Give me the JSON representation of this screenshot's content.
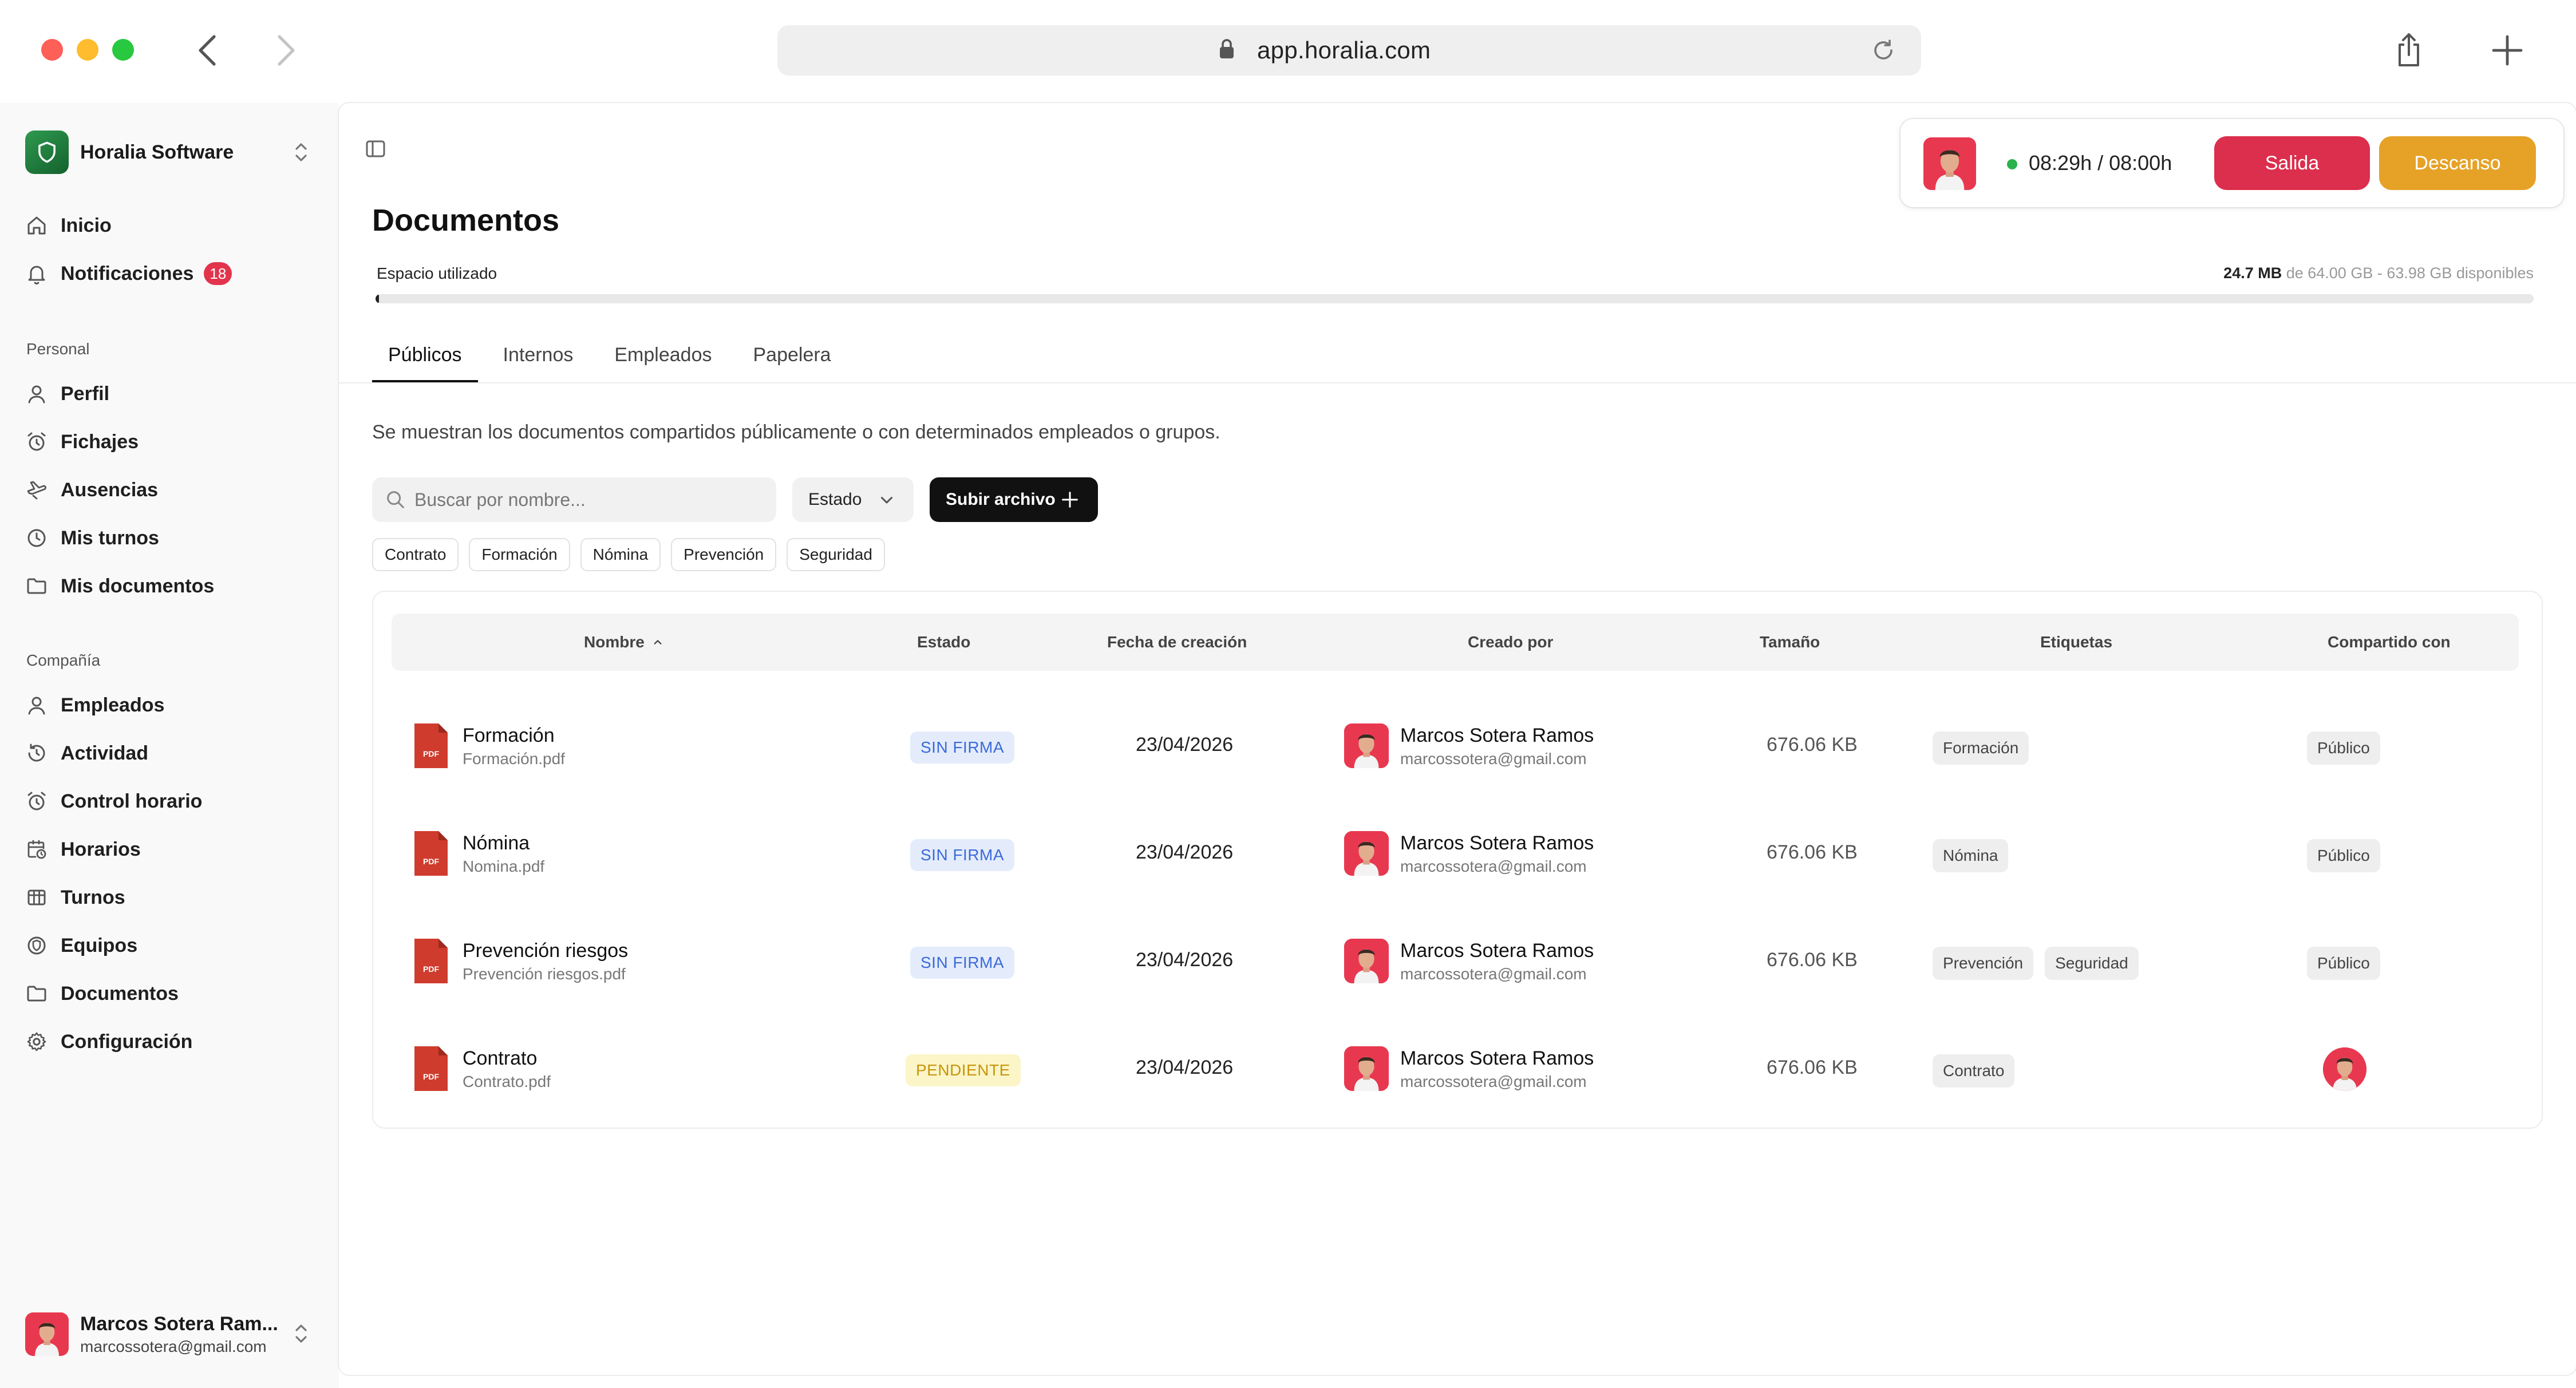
{
  "browser": {
    "url": "app.horalia.com"
  },
  "sidebar": {
    "workspace": "Horalia Software",
    "main_items": [
      {
        "label": "Inicio",
        "icon": "home-icon"
      },
      {
        "label": "Notificaciones",
        "icon": "bell-icon",
        "badge": "18"
      }
    ],
    "personal_heading": "Personal",
    "personal_items": [
      {
        "label": "Perfil",
        "icon": "user-icon"
      },
      {
        "label": "Fichajes",
        "icon": "alarm-clock-icon"
      },
      {
        "label": "Ausencias",
        "icon": "plane-icon"
      },
      {
        "label": "Mis turnos",
        "icon": "clock-icon"
      },
      {
        "label": "Mis documentos",
        "icon": "folder-icon"
      }
    ],
    "company_heading": "Compañía",
    "company_items": [
      {
        "label": "Empleados",
        "icon": "users-icon"
      },
      {
        "label": "Actividad",
        "icon": "history-icon"
      },
      {
        "label": "Control horario",
        "icon": "alarm-clock-icon"
      },
      {
        "label": "Horarios",
        "icon": "calendar-clock-icon"
      },
      {
        "label": "Turnos",
        "icon": "columns-icon"
      },
      {
        "label": "Equipos",
        "icon": "shield-icon"
      },
      {
        "label": "Documentos",
        "icon": "folder-icon"
      },
      {
        "label": "Configuración",
        "icon": "gear-icon"
      }
    ],
    "user": {
      "name": "Marcos Sotera Ram...",
      "email": "marcossotera@gmail.com"
    }
  },
  "clock": {
    "time": "08:29h / 08:00h",
    "salida_label": "Salida",
    "descanso_label": "Descanso",
    "status_color": "#2bb24c"
  },
  "page": {
    "title": "Documentos",
    "storage_label": "Espacio utilizado",
    "storage_used": "24.7 MB",
    "storage_rest": " de 64.00 GB - 63.98 GB disponibles",
    "storage_fraction": 0.0004,
    "tabs": [
      "Públicos",
      "Internos",
      "Empleados",
      "Papelera"
    ],
    "active_tab": 0,
    "description": "Se muestran los documentos compartidos públicamente o con determinados empleados o grupos.",
    "search_placeholder": "Buscar por nombre...",
    "estado_label": "Estado",
    "upload_label": "Subir archivo",
    "filter_chips": [
      "Contrato",
      "Formación",
      "Nómina",
      "Prevención",
      "Seguridad"
    ]
  },
  "table": {
    "headers": {
      "nombre": "Nombre",
      "estado": "Estado",
      "fecha": "Fecha de creación",
      "creado": "Creado por",
      "tamano": "Tamaño",
      "etiquetas": "Etiquetas",
      "compartido": "Compartido con"
    },
    "rows": [
      {
        "name": "Formación",
        "file": "Formación.pdf",
        "status": "SIN FIRMA",
        "status_kind": "blue",
        "date": "23/04/2026",
        "creator": "Marcos Sotera Ramos",
        "creator_email": "marcossotera@gmail.com",
        "size": "676.06 KB",
        "tags": [
          "Formación"
        ],
        "shared": "Público"
      },
      {
        "name": "Nómina",
        "file": "Nomina.pdf",
        "status": "SIN FIRMA",
        "status_kind": "blue",
        "date": "23/04/2026",
        "creator": "Marcos Sotera Ramos",
        "creator_email": "marcossotera@gmail.com",
        "size": "676.06 KB",
        "tags": [
          "Nómina"
        ],
        "shared": "Público"
      },
      {
        "name": "Prevención riesgos",
        "file": "Prevención riesgos.pdf",
        "status": "SIN FIRMA",
        "status_kind": "blue",
        "date": "23/04/2026",
        "creator": "Marcos Sotera Ramos",
        "creator_email": "marcossotera@gmail.com",
        "size": "676.06 KB",
        "tags": [
          "Prevención",
          "Seguridad"
        ],
        "shared": "Público"
      },
      {
        "name": "Contrato",
        "file": "Contrato.pdf",
        "status": "PENDIENTE",
        "status_kind": "yellow",
        "date": "23/04/2026",
        "creator": "Marcos Sotera Ramos",
        "creator_email": "marcossotera@gmail.com",
        "size": "676.06 KB",
        "tags": [
          "Contrato"
        ],
        "shared": ""
      }
    ]
  }
}
